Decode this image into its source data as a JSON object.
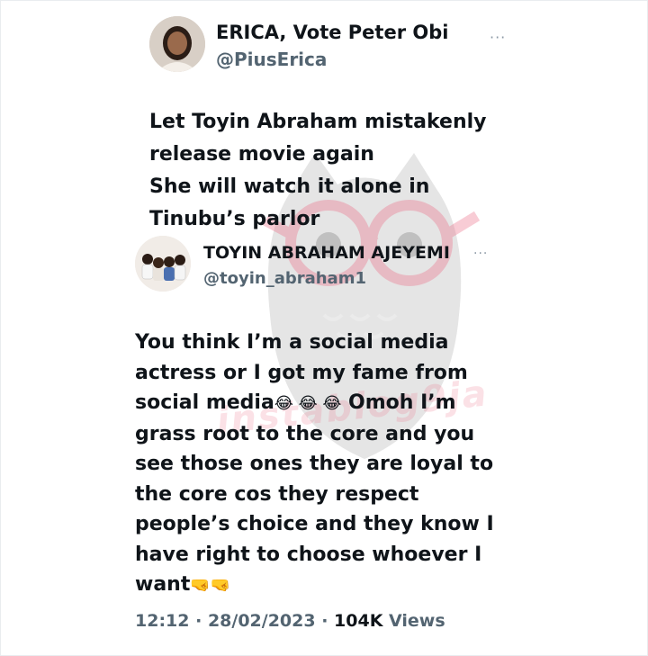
{
  "tweet": {
    "author_name": "ERICA, Vote Peter Obi",
    "author_handle": "@PiusErica",
    "more_label": "···",
    "text_lines": [
      "Let Toyin Abraham mistakenly",
      "release movie again",
      "She will watch it alone in",
      "Tinubu’s parlor"
    ]
  },
  "reply": {
    "author_name": "TOYIN ABRAHAM AJEYEMI",
    "author_handle": "@toyin_abraham1",
    "more_label": "···",
    "text_lines": [
      "You think I’m a social media",
      "actress or I got my fame from",
      "social media",
      "Omoh I’m",
      "grass root to the core and you",
      "see those ones they are loyal to",
      "the core cos they respect",
      "people’s choice and they know I",
      "have right to choose whoever I",
      "want"
    ],
    "emoji_laugh": "😂 😂 😂",
    "emoji_fist": "🤜🤜"
  },
  "meta": {
    "time": "12:12",
    "sep1": " · ",
    "date": "28/02/2023",
    "sep2": " · ",
    "views_count": "104K",
    "views_label": " Views"
  },
  "watermark": {
    "text": "instablog9ja"
  },
  "colors": {
    "text": "#0f1419",
    "muted": "#536471",
    "watermark_grey": "#8e8e8e",
    "watermark_pink": "#ec788c"
  }
}
